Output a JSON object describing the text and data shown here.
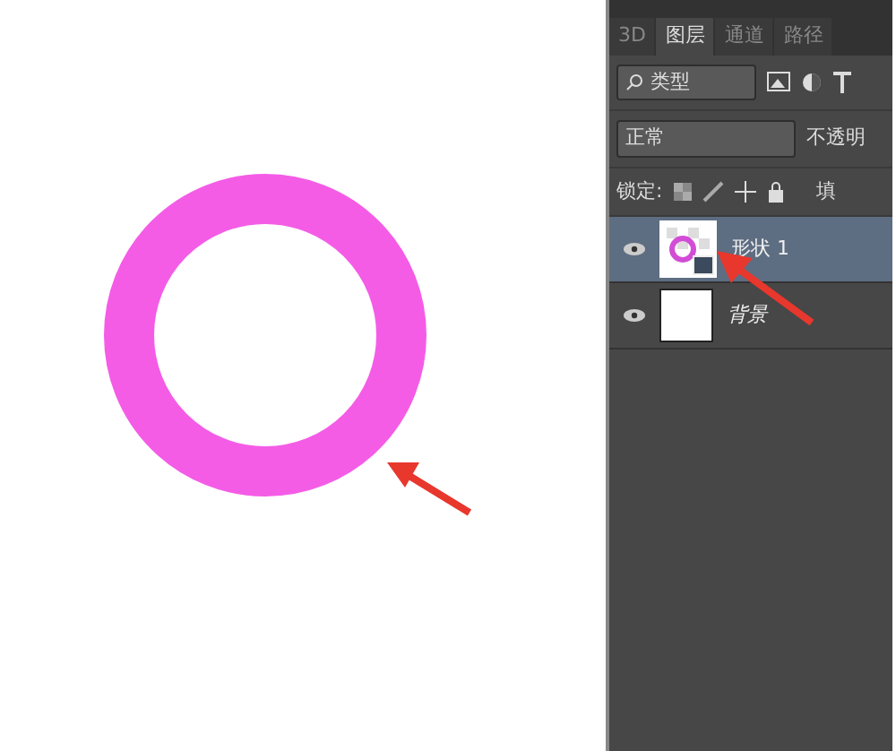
{
  "panel_tabs": [
    {
      "label": "3D",
      "selected": false
    },
    {
      "label": "图层",
      "selected": true
    },
    {
      "label": "通道",
      "selected": false
    },
    {
      "label": "路径",
      "selected": false
    }
  ],
  "filter": {
    "value": "类型"
  },
  "blend": {
    "value": "正常",
    "opacity_label": "不透明"
  },
  "lock": {
    "label": "锁定:",
    "fill_label": "填"
  },
  "layers": [
    {
      "name": "形状 1",
      "selected": true,
      "visible": true,
      "kind": "shape"
    },
    {
      "name": "背景",
      "selected": false,
      "visible": true,
      "kind": "background"
    }
  ]
}
